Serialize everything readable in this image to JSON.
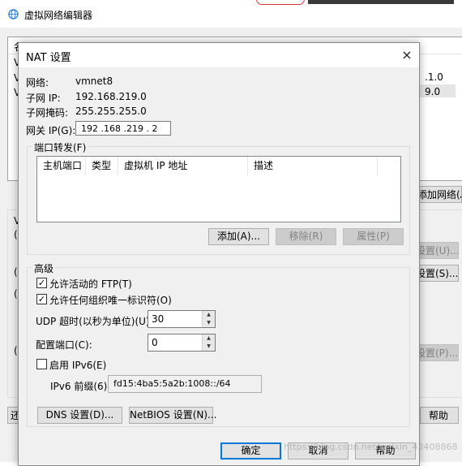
{
  "background_window": {
    "title": "虚拟网络编辑器",
    "table_header_fragment": "名",
    "row_fragments": [
      "V",
      "V",
      "V"
    ],
    "right_values": [
      ".1.0",
      "9.0"
    ],
    "button_fragments": {
      "add_network": "添加网络(A)...",
      "settings_u": "设置(U)...",
      "settings_s": "设置(S)...",
      "settings_p": "设置(P)...",
      "help": "帮助",
      "restore": "还"
    },
    "left_fragments": [
      "V",
      "(",
      "(",
      "(",
      "(",
      "「"
    ]
  },
  "dialog": {
    "title": "NAT 设置",
    "close_icon": "×",
    "network_label": "网络:",
    "network_value": "vmnet8",
    "subnet_ip_label": "子网 IP:",
    "subnet_ip_value": "192.168.219.0",
    "subnet_mask_label": "子网掩码:",
    "subnet_mask_value": "255.255.255.0",
    "gateway_label": "网关 IP(G):",
    "gateway_value": "192 .168 .219 .  2",
    "port_forwarding": {
      "title": "端口转发(F)",
      "columns": [
        "主机端口",
        "类型",
        "虚拟机 IP 地址",
        "描述"
      ],
      "add_button": "添加(A)...",
      "remove_button": "移除(R)",
      "properties_button": "属性(P)"
    },
    "advanced": {
      "title": "高级",
      "allow_ftp_label": "允许活动的 FTP(T)",
      "allow_ftp_checked": true,
      "allow_oui_label": "允许任何组织唯一标识符(O)",
      "allow_oui_checked": true,
      "udp_timeout_label": "UDP 超时(以秒为单位)(U):",
      "udp_timeout_value": "30",
      "config_port_label": "配置端口(C):",
      "config_port_value": "0",
      "enable_ipv6_label": "启用 IPv6(E)",
      "enable_ipv6_checked": false,
      "ipv6_prefix_label": "IPv6 前缀(6):",
      "ipv6_prefix_value": "fd15:4ba5:5a2b:1008::/64",
      "dns_button": "DNS 设置(D)...",
      "netbios_button": "NetBIOS 设置(N)..."
    },
    "ok_button": "确定",
    "cancel_button": "取消",
    "help_button": "帮助"
  },
  "watermark": "https://blog.csdn.net/weixin_43408868",
  "colors": {
    "focus_border": "#0078d7",
    "disabled_text": "#838383"
  }
}
